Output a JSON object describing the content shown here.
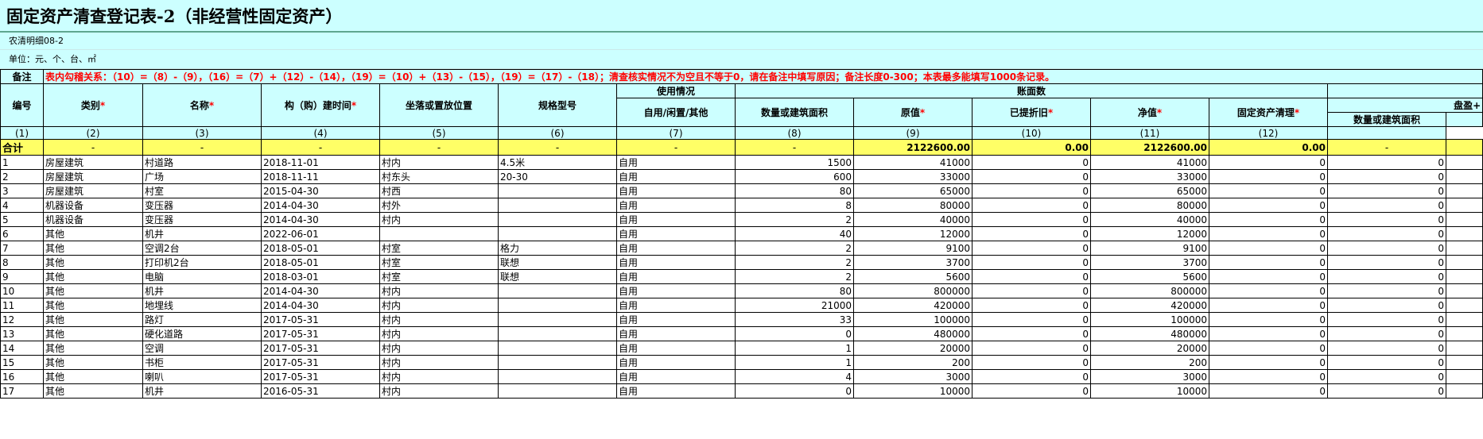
{
  "title": "固定资产清查登记表-2（非经营性固定资产）",
  "meta": {
    "code": "农清明细08-2",
    "unit": "单位：元、个、台、㎡"
  },
  "notes": {
    "label": "备注",
    "text": "表内勾稽关系：（10）=（8）-（9），（16）=（7）+（12）-（14），（19）=（10）+（13）-（15），（19）=（17）-（18）；清查核实情况不为空且不等于0，请在备注中填写原因；备注长度0-300；本表最多能填写1000条记录。"
  },
  "headers": {
    "no": "编号",
    "category": "类别",
    "name": "名称",
    "build_time": "构（购）建时间",
    "location": "坐落或置放位置",
    "spec": "规格型号",
    "usage_group": "使用情况",
    "usage": "自用/闲置/其他",
    "book_group": "账面数",
    "quantity": "数量或建筑面积",
    "original": "原值",
    "depreciation": "已提折旧",
    "net": "净值",
    "clearance": "固定资产清理",
    "surplus_group": "盘盈+",
    "surplus_quantity": "数量或建筑面积",
    "required_mark": "*"
  },
  "column_index": [
    "(1)",
    "(2)",
    "(3)",
    "(4)",
    "(5)",
    "(6)",
    "(7)",
    "(8)",
    "(9)",
    "(10)",
    "(11)",
    "(12)"
  ],
  "total": {
    "label": "合计",
    "dash": "-",
    "original": "2122600.00",
    "depreciation": "0.00",
    "net": "2122600.00",
    "clearance": "0.00"
  },
  "rows": [
    {
      "no": "1",
      "category": "房屋建筑",
      "name": "村道路",
      "time": "2018-11-01",
      "location": "村内",
      "spec": "4.5米",
      "usage": "自用",
      "qty": "1500",
      "original": "41000",
      "dep": "0",
      "net": "41000",
      "clear": "0",
      "sqty": "0"
    },
    {
      "no": "2",
      "category": "房屋建筑",
      "name": "广场",
      "time": "2018-11-11",
      "location": "村东头",
      "spec": "20-30",
      "usage": "自用",
      "qty": "600",
      "original": "33000",
      "dep": "0",
      "net": "33000",
      "clear": "0",
      "sqty": "0"
    },
    {
      "no": "3",
      "category": "房屋建筑",
      "name": "村室",
      "time": "2015-04-30",
      "location": "村西",
      "spec": "",
      "usage": "自用",
      "qty": "80",
      "original": "65000",
      "dep": "0",
      "net": "65000",
      "clear": "0",
      "sqty": "0"
    },
    {
      "no": "4",
      "category": "机器设备",
      "name": "变压器",
      "time": "2014-04-30",
      "location": "村外",
      "spec": "",
      "usage": "自用",
      "qty": "8",
      "original": "80000",
      "dep": "0",
      "net": "80000",
      "clear": "0",
      "sqty": "0"
    },
    {
      "no": "5",
      "category": "机器设备",
      "name": "变压器",
      "time": "2014-04-30",
      "location": "村内",
      "spec": "",
      "usage": "自用",
      "qty": "2",
      "original": "40000",
      "dep": "0",
      "net": "40000",
      "clear": "0",
      "sqty": "0"
    },
    {
      "no": "6",
      "category": "其他",
      "name": "机井",
      "time": "2022-06-01",
      "location": "",
      "spec": "",
      "usage": "自用",
      "qty": "40",
      "original": "12000",
      "dep": "0",
      "net": "12000",
      "clear": "0",
      "sqty": "0"
    },
    {
      "no": "7",
      "category": "其他",
      "name": "空调2台",
      "time": "2018-05-01",
      "location": "村室",
      "spec": "格力",
      "usage": "自用",
      "qty": "2",
      "original": "9100",
      "dep": "0",
      "net": "9100",
      "clear": "0",
      "sqty": "0"
    },
    {
      "no": "8",
      "category": "其他",
      "name": "打印机2台",
      "time": "2018-05-01",
      "location": "村室",
      "spec": "联想",
      "usage": "自用",
      "qty": "2",
      "original": "3700",
      "dep": "0",
      "net": "3700",
      "clear": "0",
      "sqty": "0"
    },
    {
      "no": "9",
      "category": "其他",
      "name": "电脑",
      "time": "2018-03-01",
      "location": "村室",
      "spec": "联想",
      "usage": "自用",
      "qty": "2",
      "original": "5600",
      "dep": "0",
      "net": "5600",
      "clear": "0",
      "sqty": "0"
    },
    {
      "no": "10",
      "category": "其他",
      "name": "机井",
      "time": "2014-04-30",
      "location": "村内",
      "spec": "",
      "usage": "自用",
      "qty": "80",
      "original": "800000",
      "dep": "0",
      "net": "800000",
      "clear": "0",
      "sqty": "0"
    },
    {
      "no": "11",
      "category": "其他",
      "name": "地埋线",
      "time": "2014-04-30",
      "location": "村内",
      "spec": "",
      "usage": "自用",
      "qty": "21000",
      "original": "420000",
      "dep": "0",
      "net": "420000",
      "clear": "0",
      "sqty": "0"
    },
    {
      "no": "12",
      "category": "其他",
      "name": "路灯",
      "time": "2017-05-31",
      "location": "村内",
      "spec": "",
      "usage": "自用",
      "qty": "33",
      "original": "100000",
      "dep": "0",
      "net": "100000",
      "clear": "0",
      "sqty": "0"
    },
    {
      "no": "13",
      "category": "其他",
      "name": "硬化道路",
      "time": "2017-05-31",
      "location": "村内",
      "spec": "",
      "usage": "自用",
      "qty": "0",
      "original": "480000",
      "dep": "0",
      "net": "480000",
      "clear": "0",
      "sqty": "0"
    },
    {
      "no": "14",
      "category": "其他",
      "name": "空调",
      "time": "2017-05-31",
      "location": "村内",
      "spec": "",
      "usage": "自用",
      "qty": "1",
      "original": "20000",
      "dep": "0",
      "net": "20000",
      "clear": "0",
      "sqty": "0"
    },
    {
      "no": "15",
      "category": "其他",
      "name": "书柜",
      "time": "2017-05-31",
      "location": "村内",
      "spec": "",
      "usage": "自用",
      "qty": "1",
      "original": "200",
      "dep": "0",
      "net": "200",
      "clear": "0",
      "sqty": "0"
    },
    {
      "no": "16",
      "category": "其他",
      "name": "喇叭",
      "time": "2017-05-31",
      "location": "村内",
      "spec": "",
      "usage": "自用",
      "qty": "4",
      "original": "3000",
      "dep": "0",
      "net": "3000",
      "clear": "0",
      "sqty": "0"
    },
    {
      "no": "17",
      "category": "其他",
      "name": "机井",
      "time": "2016-05-31",
      "location": "村内",
      "spec": "",
      "usage": "自用",
      "qty": "0",
      "original": "10000",
      "dep": "0",
      "net": "10000",
      "clear": "0",
      "sqty": "0"
    }
  ]
}
